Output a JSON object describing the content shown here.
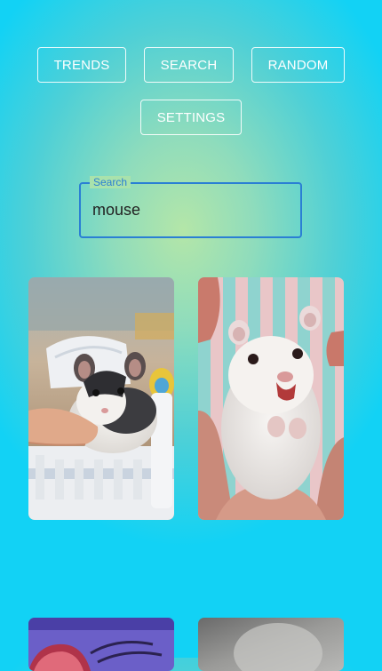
{
  "nav": {
    "trends_label": "TRENDS",
    "search_label": "SEARCH",
    "random_label": "RANDOM",
    "settings_label": "SETTINGS"
  },
  "search": {
    "label": "Search",
    "value": "mouse"
  },
  "results": [
    {
      "icon": "mouse-in-toy-bed-image"
    },
    {
      "icon": "white-hamster-held-in-hands-image"
    },
    {
      "icon": "cartoon-gif-image"
    },
    {
      "icon": "gray-gif-image"
    }
  ],
  "colors": {
    "accent": "#2a7fd4",
    "background_edge": "#12d2f5",
    "background_center": "#b4e6a8"
  }
}
